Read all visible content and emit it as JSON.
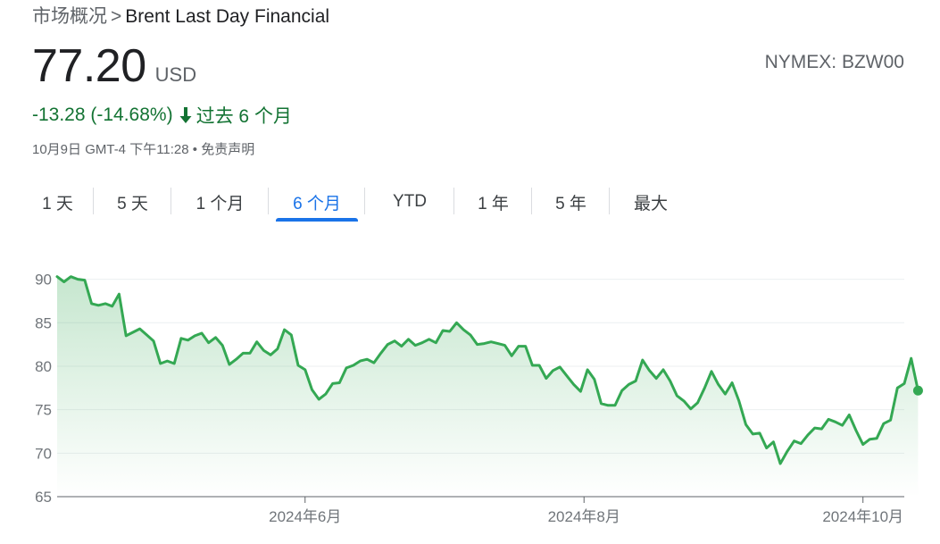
{
  "breadcrumb": {
    "parent": "市场概况",
    "separator": ">",
    "current": "Brent Last Day Financial"
  },
  "quote": {
    "price": "77.20",
    "currency": "USD",
    "ticker": "NYMEX: BZW00",
    "change": "-13.28 (-14.68%)",
    "period_label": "过去 6 个月",
    "timestamp": "10月9日 GMT-4 下午11:28 • 免责声明"
  },
  "tabs": [
    {
      "label": "1 天",
      "active": false
    },
    {
      "label": "5 天",
      "active": false
    },
    {
      "label": "1 个月",
      "active": false
    },
    {
      "label": "6 个月",
      "active": true
    },
    {
      "label": "YTD",
      "active": false
    },
    {
      "label": "1 年",
      "active": false
    },
    {
      "label": "5 年",
      "active": false
    },
    {
      "label": "最大",
      "active": false
    }
  ],
  "colors": {
    "accent": "#1a73e8",
    "line": "#34a853",
    "change": "#137333"
  },
  "chart_data": {
    "type": "area",
    "y_ticks": [
      65,
      70,
      75,
      80,
      85,
      90
    ],
    "ylim": [
      65,
      91.5
    ],
    "xlim": [
      0,
      123
    ],
    "x_ticks": [
      {
        "label": "2024年6月",
        "x": 36
      },
      {
        "label": "2024年8月",
        "x": 76.5
      },
      {
        "label": "2024年10月",
        "x": 117
      }
    ],
    "grid": true,
    "series": [
      {
        "values": [
          90.3,
          89.7,
          90.3,
          90.0,
          89.9,
          87.2,
          87.0,
          87.2,
          86.9,
          88.3,
          83.5,
          83.9,
          84.3,
          83.6,
          82.9,
          80.3,
          80.6,
          80.3,
          83.2,
          83.0,
          83.5,
          83.8,
          82.7,
          83.3,
          82.4,
          80.2,
          80.8,
          81.5,
          81.5,
          82.8,
          81.8,
          81.3,
          82.0,
          84.2,
          83.6,
          80.1,
          79.6,
          77.3,
          76.2,
          76.8,
          78.0,
          78.1,
          79.8,
          80.1,
          80.6,
          80.8,
          80.4,
          81.5,
          82.5,
          82.9,
          82.3,
          83.1,
          82.4,
          82.7,
          83.1,
          82.7,
          84.1,
          84.0,
          85.0,
          84.2,
          83.6,
          82.5,
          82.6,
          82.8,
          82.6,
          82.4,
          81.2,
          82.3,
          82.3,
          80.1,
          80.1,
          78.6,
          79.5,
          79.9,
          78.9,
          77.9,
          77.1,
          79.6,
          78.5,
          75.7,
          75.5,
          75.5,
          77.2,
          77.9,
          78.3,
          80.7,
          79.5,
          78.6,
          79.6,
          78.3,
          76.6,
          76.0,
          75.1,
          75.8,
          77.5,
          79.4,
          77.9,
          76.8,
          78.1,
          76.0,
          73.3,
          72.2,
          72.3,
          70.6,
          71.3,
          68.8,
          70.2,
          71.4,
          71.1,
          72.1,
          72.9,
          72.8,
          73.9,
          73.6,
          73.2,
          74.4,
          72.6,
          71.0,
          71.6,
          71.7,
          73.4,
          73.8,
          77.5,
          78.0,
          80.9,
          77.2
        ]
      }
    ]
  }
}
